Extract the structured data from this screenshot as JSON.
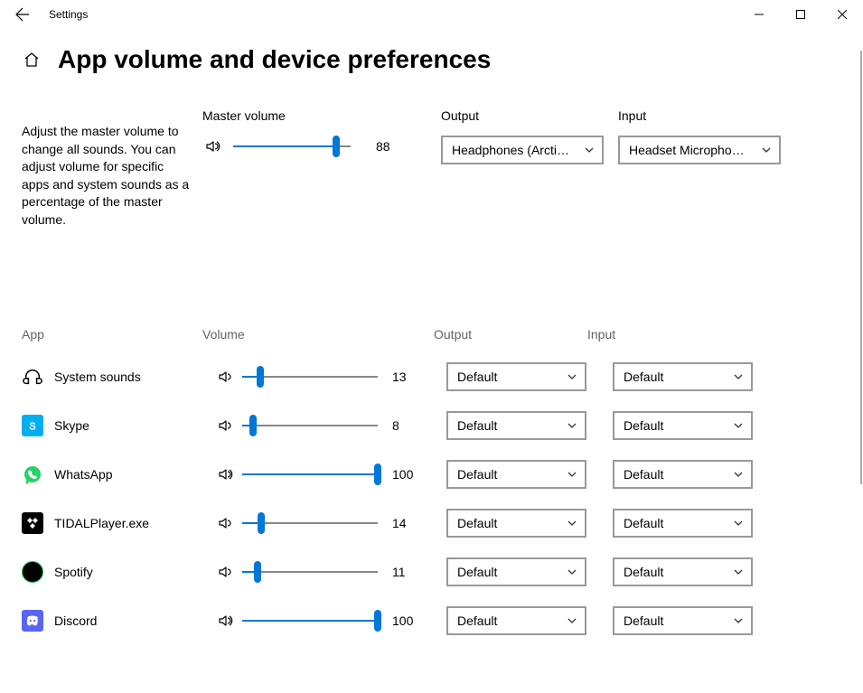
{
  "window": {
    "title": "Settings"
  },
  "page": {
    "title": "App volume and device preferences",
    "description": "Adjust the master volume to change all sounds. You can adjust volume for specific apps and system sounds as a percentage of the master volume."
  },
  "master": {
    "label": "Master volume",
    "value": "88",
    "volume": 88
  },
  "output": {
    "label": "Output",
    "value": "Headphones (Arcti…"
  },
  "input": {
    "label": "Input",
    "value": "Headset Micropho…"
  },
  "table": {
    "app_header": "App",
    "vol_header": "Volume",
    "out_header": "Output",
    "in_header": "Input"
  },
  "apps": [
    {
      "name": "System sounds",
      "value": "13",
      "volume": 13,
      "output": "Default",
      "input": "Default",
      "icon": "headphones",
      "bg": "transparent",
      "fg": "#000"
    },
    {
      "name": "Skype",
      "value": "8",
      "volume": 8,
      "output": "Default",
      "input": "Default",
      "icon": "skype",
      "bg": "#00aff0",
      "fg": "#fff"
    },
    {
      "name": "WhatsApp",
      "value": "100",
      "volume": 100,
      "output": "Default",
      "input": "Default",
      "icon": "whatsapp",
      "bg": "transparent",
      "fg": "#25d366"
    },
    {
      "name": "TIDALPlayer.exe",
      "value": "14",
      "volume": 14,
      "output": "Default",
      "input": "Default",
      "icon": "tidal",
      "bg": "#000",
      "fg": "#fff"
    },
    {
      "name": "Spotify",
      "value": "11",
      "volume": 11,
      "output": "Default",
      "input": "Default",
      "icon": "spotify",
      "bg": "#1db954",
      "fg": "#000"
    },
    {
      "name": "Discord",
      "value": "100",
      "volume": 100,
      "output": "Default",
      "input": "Default",
      "icon": "discord",
      "bg": "#5865f2",
      "fg": "#fff"
    }
  ]
}
